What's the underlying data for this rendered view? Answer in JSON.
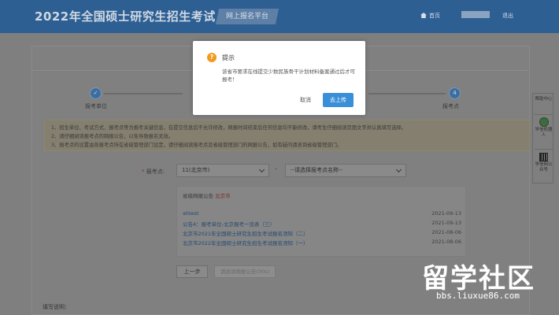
{
  "header": {
    "title": "2022年全国硕士研究生招生考试",
    "platform_tab": "网上报名平台",
    "home_label": "首页",
    "logout_label": "退出"
  },
  "steps": {
    "step1_label": "报考单位",
    "step1_icon": "check-icon",
    "step4_number": "4",
    "step4_label": "报考点"
  },
  "notice": {
    "items": [
      "1、招生单位、考试方式、报考点等为报考关键信息，在提交信息后不允许修改，网报时间结束后任何信息均不能修改，请考生仔细阅读页面文字并认真填写选择。",
      "2、请仔细阅读报考点的网报公告，以免导致报名无效。",
      "3、报考点的设置由各报考点所在省级管理部门设定，请仔细阅读报考点及省级管理部门的网报公告，如有疑问请咨询省级管理部门。"
    ]
  },
  "form": {
    "label": "报考点:",
    "province_value": "11(北京市)",
    "dash": "-",
    "site_placeholder": "--请选择报考点名称--"
  },
  "announcements": {
    "heading_prefix": "省级网报公告",
    "heading_city": "北京市",
    "rows": [
      {
        "title": "ahtest",
        "date": "2021-09-13"
      },
      {
        "title": "公告4：报考单位-北京报考一览表（三）",
        "date": "2021-09-13"
      },
      {
        "title": "北京市2021年全国硕士研究生招生考试报名须知（二）",
        "date": "2021-08-06"
      },
      {
        "title": "北京市2022年全国硕士研究生招生考试报名须知（一）",
        "date": "2021-08-06"
      }
    ]
  },
  "buttons": {
    "prev": "上一步",
    "read": "请阅读网报公告(30s)"
  },
  "footer": {
    "note": "填写说明："
  },
  "side": {
    "help": "帮助中心",
    "robot": "学信机器人",
    "qr": "学信网公众号"
  },
  "modal": {
    "icon": "?",
    "title": "提示",
    "body": "该省市要求在线提交少数民族骨干计划材料备案通过后才可报考！",
    "cancel": "取消",
    "confirm": "去上传"
  },
  "watermark": {
    "big": "留学社区",
    "url": "bbs.liuxue86.com"
  }
}
